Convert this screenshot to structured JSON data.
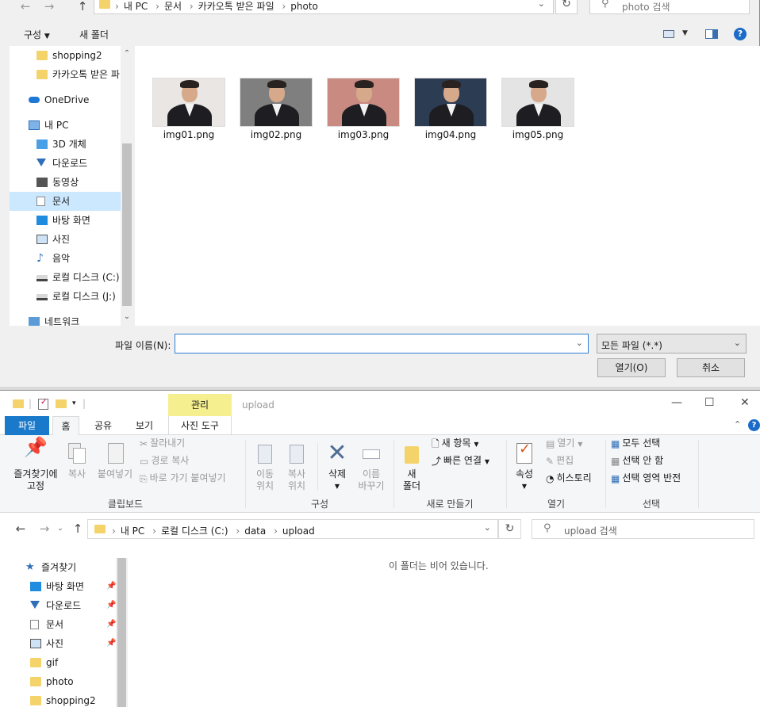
{
  "dialog": {
    "address": {
      "crumbs": [
        "내 PC",
        "문서",
        "카카오톡 받은 파일",
        "photo"
      ]
    },
    "search_placeholder": "photo 검색",
    "toolbar": {
      "organize": "구성",
      "new_folder": "새 폴더"
    },
    "nav": [
      {
        "label": "shopping2",
        "icon": "folder-icon"
      },
      {
        "label": "카카오톡 받은 파",
        "icon": "folder-icon"
      },
      {
        "label": "OneDrive",
        "icon": "cloud-icon"
      },
      {
        "label": "내 PC",
        "icon": "computer-icon"
      },
      {
        "label": "3D 개체",
        "icon": "cube-icon"
      },
      {
        "label": "다운로드",
        "icon": "download-icon"
      },
      {
        "label": "동영상",
        "icon": "video-icon"
      },
      {
        "label": "문서",
        "icon": "document-icon",
        "selected": true
      },
      {
        "label": "바탕 화면",
        "icon": "desktop-icon"
      },
      {
        "label": "사진",
        "icon": "picture-icon"
      },
      {
        "label": "음악",
        "icon": "music-icon"
      },
      {
        "label": "로컬 디스크 (C:)",
        "icon": "drive-icon"
      },
      {
        "label": "로컬 디스크 (J:)",
        "icon": "drive-icon"
      },
      {
        "label": "네트워크",
        "icon": "network-icon"
      }
    ],
    "files": [
      {
        "name": "img01.png",
        "bg": "#e9e6e3"
      },
      {
        "name": "img02.png",
        "bg": "#7f7f7f"
      },
      {
        "name": "img03.png",
        "bg": "#c98a82"
      },
      {
        "name": "img04.png",
        "bg": "#2c3c52"
      },
      {
        "name": "img05.png",
        "bg": "#e4e4e4"
      }
    ],
    "filename_label": "파일 이름(N):",
    "filename_value": "",
    "filetype": "모든 파일 (*.*)",
    "open_button": "열기(O)",
    "cancel_button": "취소"
  },
  "explorer": {
    "title": "upload",
    "manage_tab": "관리",
    "tabs": {
      "file": "파일",
      "home": "홈",
      "share": "공유",
      "view": "보기",
      "picture_tools": "사진 도구"
    },
    "ribbon": {
      "pin": [
        "즐겨찾기에",
        "고정"
      ],
      "copy": "복사",
      "paste": "붙여넣기",
      "cut": "잘라내기",
      "copy_path": "경로 복사",
      "paste_shortcut": "바로 가기 붙여넣기",
      "clipboard_group": "클립보드",
      "move_to": [
        "이동",
        "위치"
      ],
      "copy_to": [
        "복사",
        "위치"
      ],
      "delete": "삭제",
      "rename": [
        "이름",
        "바꾸기"
      ],
      "organize_group": "구성",
      "new_folder": [
        "새",
        "폴더"
      ],
      "new_item": "새 항목",
      "easy_access": "빠른 연결",
      "new_group": "새로 만들기",
      "properties": "속성",
      "open": "열기",
      "edit": "편집",
      "history": "히스토리",
      "open_group": "열기",
      "select_all": "모두 선택",
      "select_none": "선택 안 함",
      "invert_selection": "선택 영역 반전",
      "select_group": "선택"
    },
    "address": {
      "crumbs": [
        "내 PC",
        "로컬 디스크 (C:)",
        "data",
        "upload"
      ]
    },
    "search_placeholder": "upload 검색",
    "nav": [
      {
        "label": "즐겨찾기",
        "icon": "star-icon"
      },
      {
        "label": "바탕 화면",
        "icon": "desktop-icon",
        "pinned": true
      },
      {
        "label": "다운로드",
        "icon": "download-icon",
        "pinned": true
      },
      {
        "label": "문서",
        "icon": "document-icon",
        "pinned": true
      },
      {
        "label": "사진",
        "icon": "picture-icon",
        "pinned": true
      },
      {
        "label": "gif",
        "icon": "folder-icon"
      },
      {
        "label": "photo",
        "icon": "folder-icon"
      },
      {
        "label": "shopping2",
        "icon": "folder-icon"
      }
    ],
    "empty_message": "이 폴더는 비어 있습니다."
  }
}
